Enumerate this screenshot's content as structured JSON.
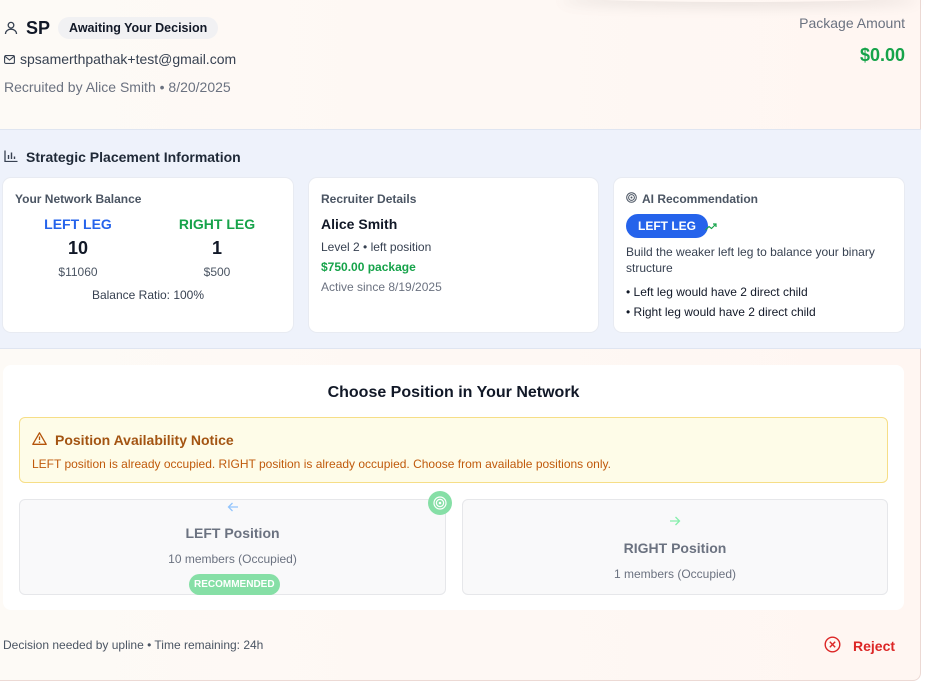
{
  "header": {
    "initials": "SP",
    "status_badge": "Awaiting Your Decision",
    "email": "spsamerthpathak+test@gmail.com",
    "recruited_by": "Recruited by Alice Smith • 8/20/2025",
    "package_label": "Package Amount",
    "package_amount": "$0.00"
  },
  "strategic": {
    "title": "Strategic Placement Information",
    "balance": {
      "title": "Your Network Balance",
      "left": {
        "label": "LEFT LEG",
        "count": "10",
        "amount": "$11060"
      },
      "right": {
        "label": "RIGHT LEG",
        "count": "1",
        "amount": "$500"
      },
      "ratio": "Balance Ratio: 100%"
    },
    "recruiter": {
      "title": "Recruiter Details",
      "name": "Alice Smith",
      "level": "Level 2 • left position",
      "package": "$750.00 package",
      "active": "Active since 8/19/2025"
    },
    "ai": {
      "title": "AI Recommendation",
      "badge": "LEFT LEG",
      "description": "Build the weaker left leg to balance your binary structure",
      "bullet1": "• Left leg would have 2 direct child",
      "bullet2": "• Right leg would have 2 direct child"
    }
  },
  "choose": {
    "title": "Choose Position in Your Network",
    "notice_title": "Position Availability Notice",
    "notice_text": "LEFT position is already occupied. RIGHT position is already occupied. Choose from available positions only.",
    "left": {
      "label": "LEFT Position",
      "members": "10 members (Occupied)",
      "badge": "RECOMMENDED"
    },
    "right": {
      "label": "RIGHT Position",
      "members": "1 members (Occupied)"
    }
  },
  "footer": {
    "deadline": "Decision needed by upline • Time remaining: 24h",
    "reject_label": "Reject"
  },
  "colors": {
    "accent_blue": "#2563eb",
    "success_green": "#16a34a",
    "danger_red": "#dc2626",
    "warning_text": "#c05a0c"
  }
}
